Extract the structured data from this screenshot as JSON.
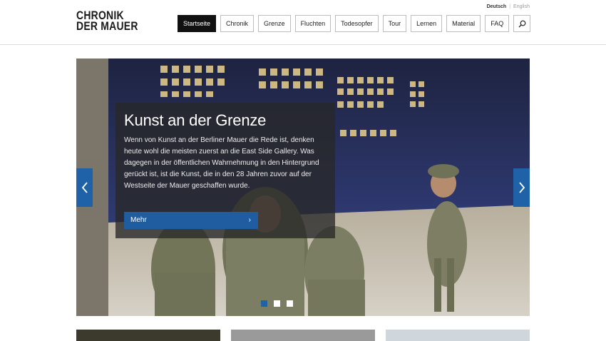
{
  "site": {
    "logo_line1": "CHRONIK",
    "logo_line2": "DER MAUER"
  },
  "language": {
    "active": "Deutsch",
    "other": "English",
    "separator": "|"
  },
  "nav": {
    "items": [
      {
        "label": "Startseite",
        "active": true
      },
      {
        "label": "Chronik",
        "active": false
      },
      {
        "label": "Grenze",
        "active": false
      },
      {
        "label": "Fluchten",
        "active": false
      },
      {
        "label": "Todesopfer",
        "active": false
      },
      {
        "label": "Tour",
        "active": false
      },
      {
        "label": "Lernen",
        "active": false
      },
      {
        "label": "Material",
        "active": false
      },
      {
        "label": "FAQ",
        "active": false
      }
    ],
    "search_icon": "search-icon"
  },
  "slider": {
    "title": "Kunst an der Grenze",
    "text": "Wenn von Kunst an der Berliner Mauer die Rede ist, denken heute wohl die meisten zuerst an die East Side Gallery. Was dagegen in der öffentlichen Wahrnehmung in den Hintergrund gerückt ist, ist die Kunst, die in den 28 Jahren zuvor auf der Westseite der Mauer geschaffen wurde.",
    "button_label": "Mehr",
    "prev_icon": "chevron-left-icon",
    "next_icon": "chevron-right-icon",
    "slide_count": 3,
    "active_slide": 1
  },
  "colors": {
    "accent": "#1f62a8",
    "nav_active_bg": "#111111"
  }
}
